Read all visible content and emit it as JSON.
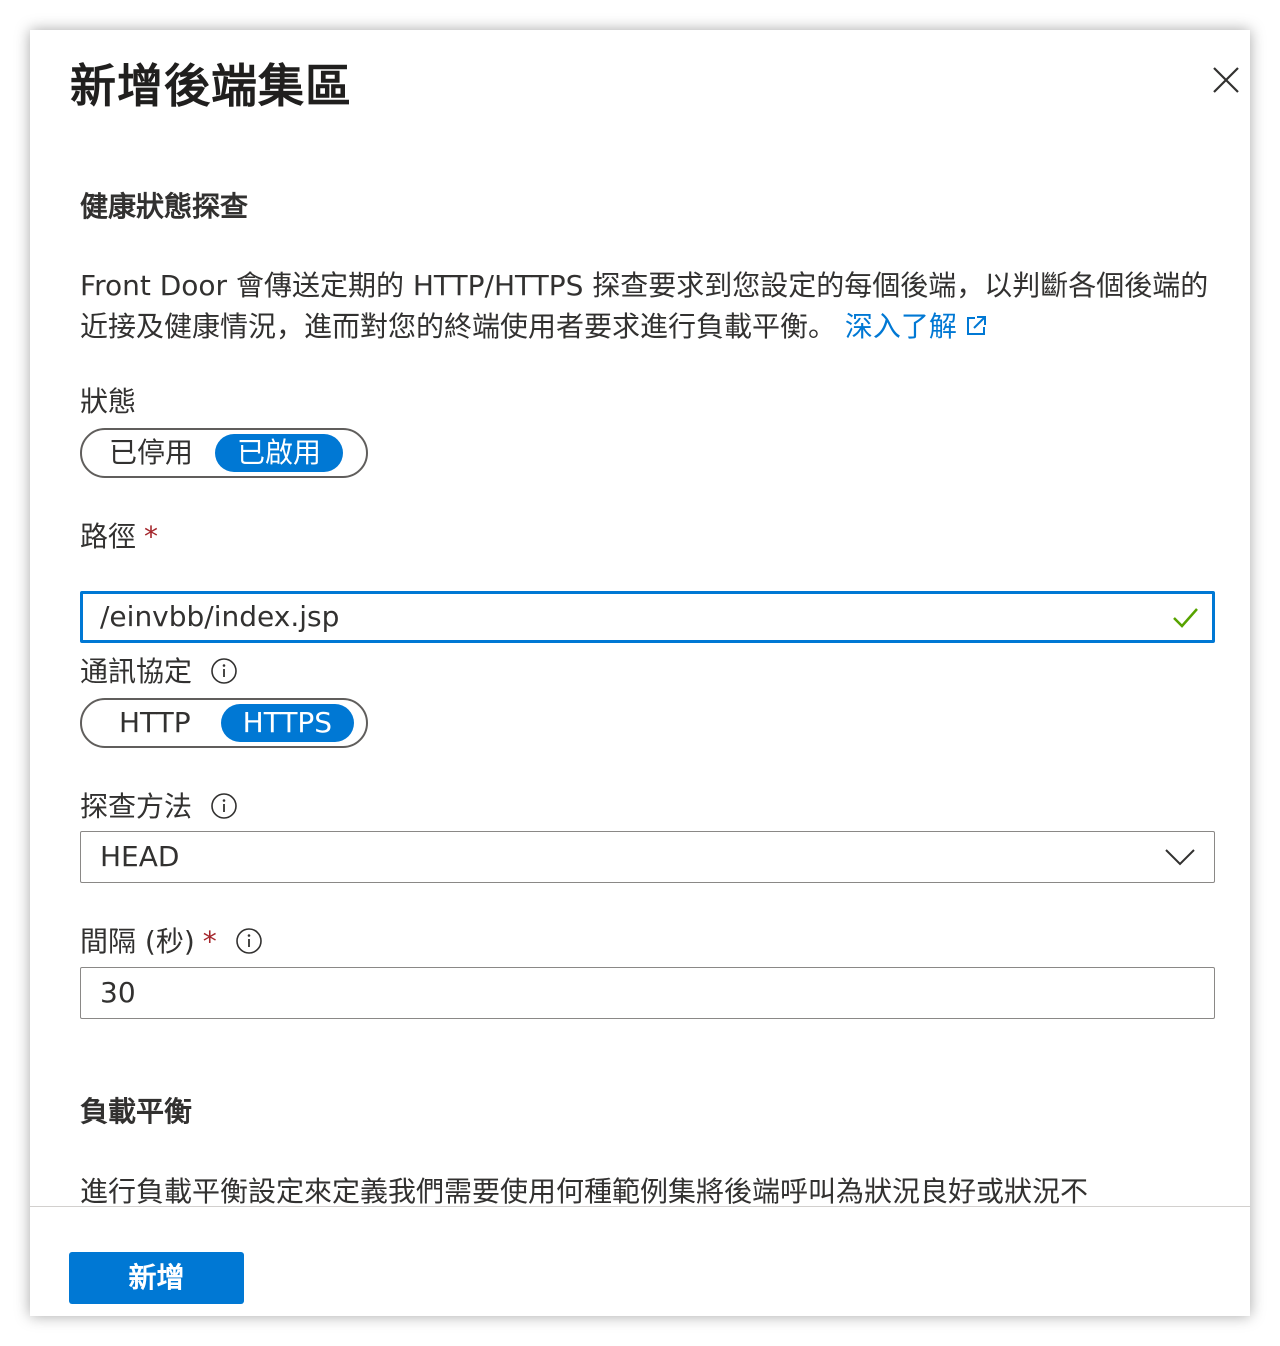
{
  "header": {
    "title": "新增後端集區"
  },
  "health_probe": {
    "section_title": "健康狀態探查",
    "description": "Front Door 會傳送定期的 HTTP/HTTPS 探查要求到您設定的每個後端，以判斷各個後端的近接及健康情況，進而對您的終端使用者要求進行負載平衡。 ",
    "learn_more": "深入了解",
    "status": {
      "label": "狀態",
      "options": [
        "已停用",
        "已啟用"
      ],
      "selected": "已啟用"
    },
    "path": {
      "label": "路徑",
      "required_mark": "*",
      "value": "/einvbb/index.jsp"
    },
    "protocol": {
      "label": "通訊協定",
      "options": [
        "HTTP",
        "HTTPS"
      ],
      "selected": "HTTPS"
    },
    "method": {
      "label": "探查方法",
      "value": "HEAD"
    },
    "interval": {
      "label": "間隔 (秒)",
      "required_mark": "*",
      "value": "30"
    }
  },
  "load_balancing": {
    "section_title": "負載平衡",
    "description": "進行負載平衡設定來定義我們需要使用何種範例集將後端呼叫為狀況良好或狀況不"
  },
  "footer": {
    "add_button": "新增"
  },
  "colors": {
    "accent": "#0078d4",
    "required": "#a4262c",
    "valid": "#57a300",
    "text": "#323130"
  },
  "icons": [
    "close-icon",
    "external-link-icon",
    "info-icon",
    "check-icon",
    "chevron-down-icon"
  ]
}
